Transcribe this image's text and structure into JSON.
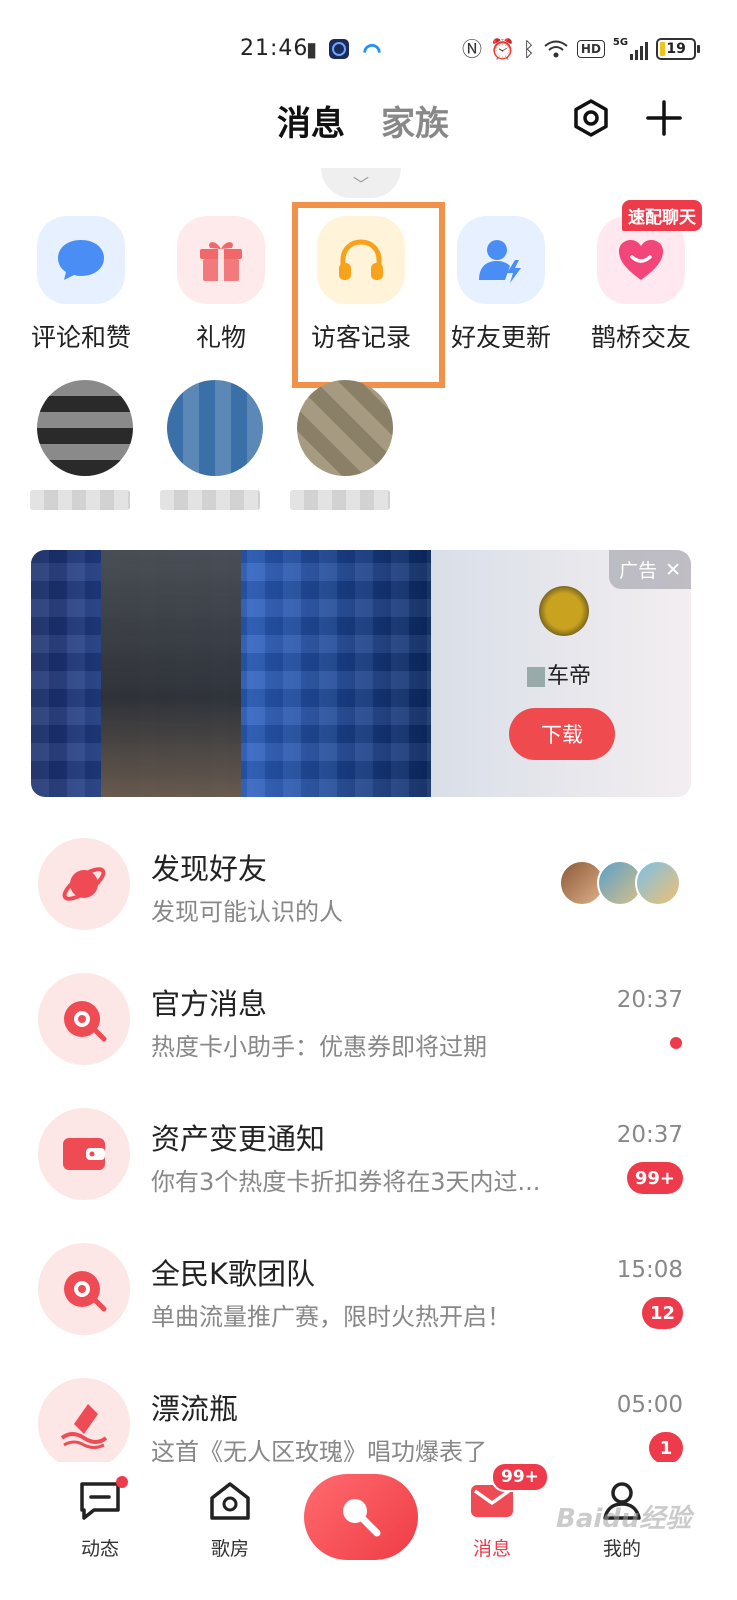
{
  "status_bar": {
    "time": "21:46",
    "signal_label": "5G",
    "hd_label": "HD",
    "battery_level": "19"
  },
  "header": {
    "tabs": [
      {
        "label": "消息",
        "active": true
      },
      {
        "label": "家族",
        "active": false
      }
    ],
    "icons": [
      "settings-icon",
      "plus-icon"
    ]
  },
  "quick_actions": [
    {
      "label": "评论和赞",
      "icon": "chat-bubble-icon",
      "color": "#4a8ef5",
      "bg": "#e6f0ff"
    },
    {
      "label": "礼物",
      "icon": "gift-icon",
      "color": "#f0686a",
      "bg": "#feeaea"
    },
    {
      "label": "访客记录",
      "icon": "headphones-icon",
      "color": "#f7a21b",
      "bg": "#fff3da"
    },
    {
      "label": "好友更新",
      "icon": "user-update-icon",
      "color": "#4a8ef5",
      "bg": "#e6f0ff"
    },
    {
      "label": "鹊桥交友",
      "icon": "heart-icon",
      "color": "#f2457a",
      "bg": "#ffe8ef",
      "badge": "速配聊天"
    }
  ],
  "ad": {
    "tag": "广告",
    "brand": "车帝",
    "download_label": "下载"
  },
  "messages": [
    {
      "title": "发现好友",
      "subtitle": "发现可能认识的人",
      "icon": "planet-icon"
    },
    {
      "title": "官方消息",
      "subtitle": "热度卡小助手：优惠券即将过期",
      "time": "20:37",
      "dot": true,
      "icon": "official-icon"
    },
    {
      "title": "资产变更通知",
      "subtitle": "你有3个热度卡折扣券将在3天内过...",
      "time": "20:37",
      "badge": "99+",
      "icon": "wallet-icon"
    },
    {
      "title": "全民K歌团队",
      "subtitle": "单曲流量推广赛，限时火热开启！",
      "time": "15:08",
      "badge": "12",
      "icon": "team-icon"
    },
    {
      "title": "漂流瓶",
      "subtitle": "这首《无人区玫瑰》唱功爆表了",
      "time": "05:00",
      "badge": "1",
      "icon": "bottle-icon"
    }
  ],
  "bottom_nav": [
    {
      "label": "动态",
      "icon": "feed-icon"
    },
    {
      "label": "歌房",
      "icon": "room-icon"
    },
    {
      "label": "",
      "icon": "microphone-icon"
    },
    {
      "label": "消息",
      "icon": "message-icon",
      "active": true,
      "badge": "99+"
    },
    {
      "label": "我的",
      "icon": "profile-icon"
    }
  ],
  "watermark": "Baidu经验",
  "colors": {
    "accent": "#ee3b4b",
    "highlight": "#f2924a"
  }
}
